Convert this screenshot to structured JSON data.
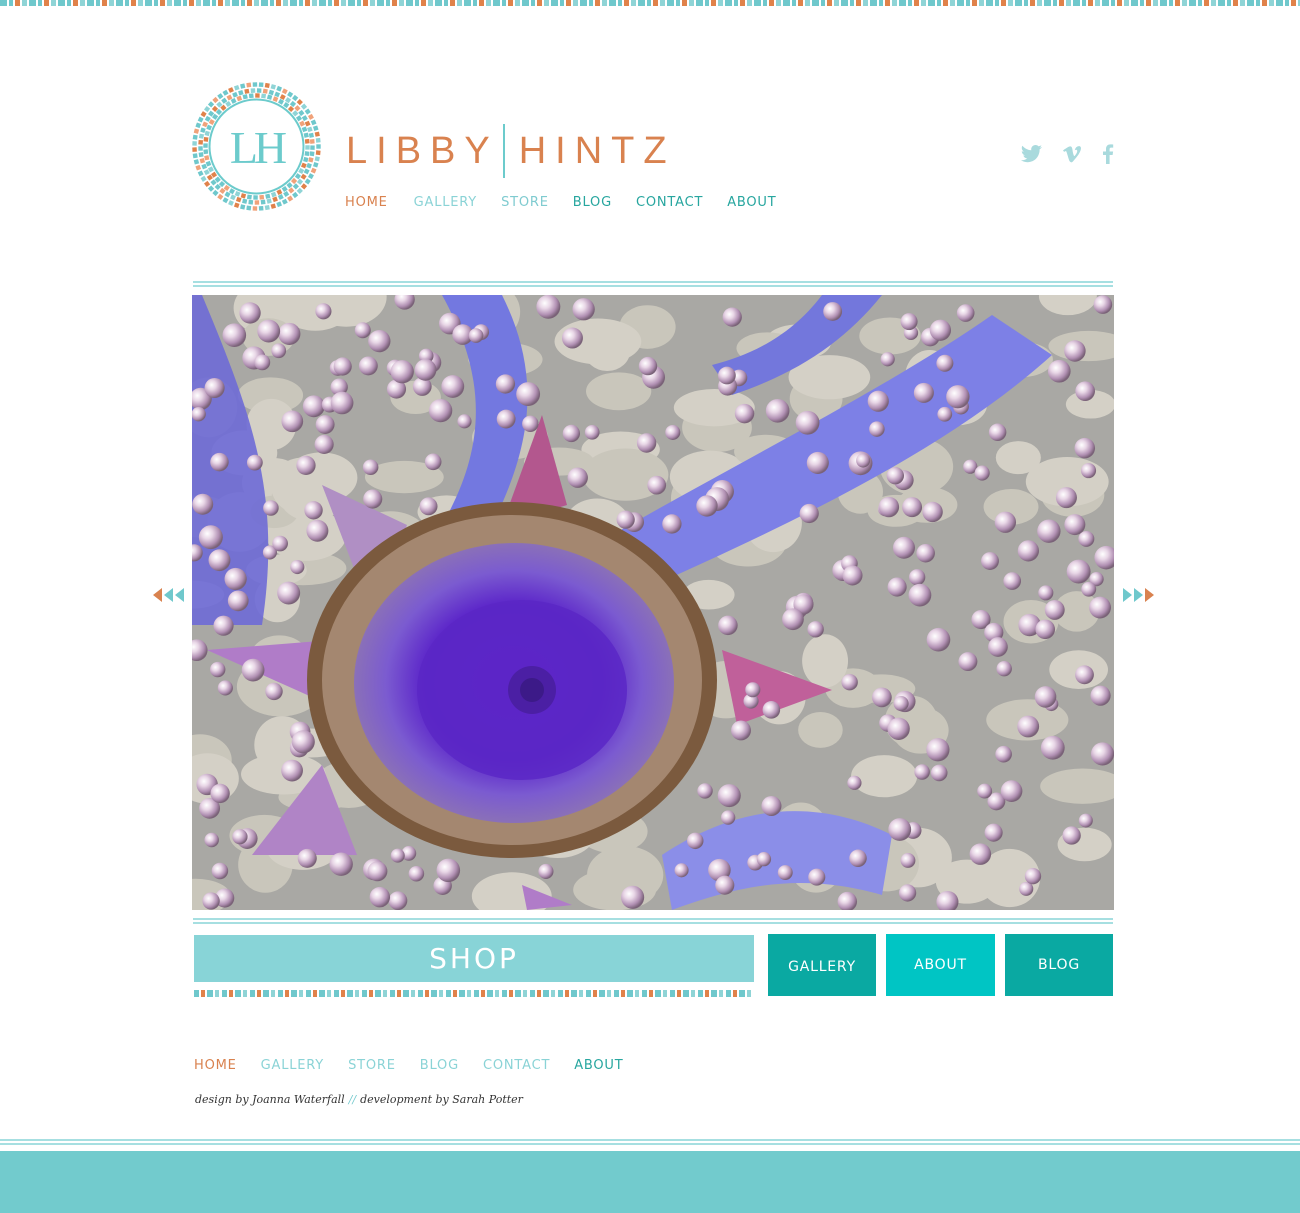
{
  "colors": {
    "orange": "#d9824f",
    "aqua_light": "#8ad3d6",
    "teal": "#27a69f",
    "teal_dark": "#0aa9a2",
    "turquoise": "#00c5c4",
    "shop_bg": "#88d4d7",
    "footer_band": "#72cbcd"
  },
  "brand": {
    "monogram": "LH",
    "first_name": "LIBBY",
    "last_name": "HINTZ"
  },
  "nav": {
    "items": [
      {
        "label": "HOME",
        "state": "active"
      },
      {
        "label": "GALLERY"
      },
      {
        "label": "STORE"
      },
      {
        "label": "BLOG"
      },
      {
        "label": "CONTACT"
      },
      {
        "label": "ABOUT"
      }
    ]
  },
  "social": {
    "icons": [
      "twitter-icon",
      "vimeo-icon",
      "facebook-icon"
    ]
  },
  "slider": {
    "image": "mosaic artwork with purple agate slice, iridescent glass beads and sea glass",
    "prev_icon": "triple-left-arrow-icon",
    "next_icon": "triple-right-arrow-icon"
  },
  "cta": {
    "shop_label": "SHOP",
    "tiles": [
      {
        "label": "GALLERY"
      },
      {
        "label": "ABOUT"
      },
      {
        "label": "BLOG"
      }
    ]
  },
  "footer": {
    "nav": [
      {
        "label": "HOME"
      },
      {
        "label": "GALLERY"
      },
      {
        "label": "STORE"
      },
      {
        "label": "BLOG"
      },
      {
        "label": "CONTACT"
      },
      {
        "label": "ABOUT"
      }
    ],
    "design_credit": "design by Joanna Waterfall",
    "separator": "//",
    "dev_credit": "development by Sarah Potter"
  }
}
